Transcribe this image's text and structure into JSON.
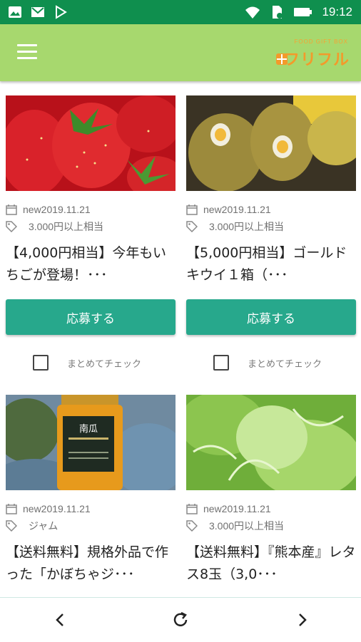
{
  "status_bar": {
    "time": "19:12"
  },
  "app": {
    "logo_small": "FOOD GIFT BOX",
    "logo_text": "フリフル"
  },
  "products": [
    {
      "date": "new2019.11.21",
      "tag": "3.000円以上相当",
      "title": "【4,000円相当】今年もいちごが登場！･･･",
      "apply_label": "応募する",
      "check_label": "まとめてチェック"
    },
    {
      "date": "new2019.11.21",
      "tag": "3.000円以上相当",
      "title": "【5,000円相当】ゴールドキウイ１箱（･･･",
      "apply_label": "応募する",
      "check_label": "まとめてチェック"
    },
    {
      "date": "new2019.11.21",
      "tag": "ジャム",
      "title": "【送料無料】規格外品で作った「かぼちゃジ･･･",
      "label_jar": "南瓜"
    },
    {
      "date": "new2019.11.21",
      "tag": "3.000円以上相当",
      "title": "【送料無料】『熊本産』レタス8玉（3,0･･･"
    }
  ],
  "colors": {
    "status_bar": "#0f8f4e",
    "app_bar": "#a7d86e",
    "button": "#27a88c",
    "logo": "#f39a2b"
  }
}
